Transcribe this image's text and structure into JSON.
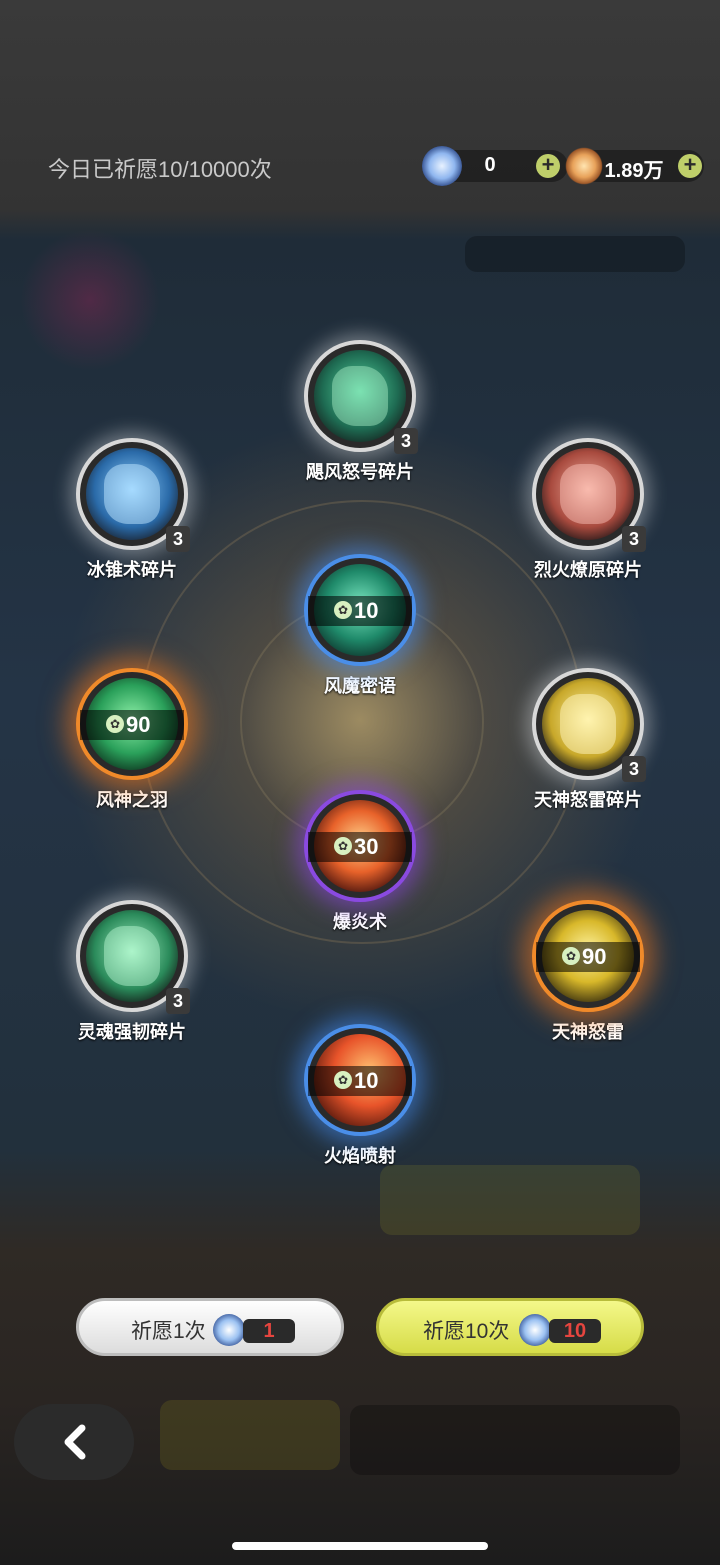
{
  "header": {
    "wish_count": "今日已祈愿10/10000次",
    "crystal_value": "0",
    "crystal_icon": "blue-crystal-icon",
    "star_value": "1.89万",
    "star_icon": "orange-star-icon",
    "plus_symbol": "+"
  },
  "items": [
    {
      "name": "飓风怒号碎片",
      "kind": "fragment",
      "count": "3",
      "rarity": "grey",
      "color": "#2fa37a"
    },
    {
      "name": "冰锥术碎片",
      "kind": "fragment",
      "count": "3",
      "rarity": "grey",
      "color": "#4aa7e8"
    },
    {
      "name": "烈火燎原碎片",
      "kind": "fragment",
      "count": "3",
      "rarity": "grey",
      "color": "#e07a6a"
    },
    {
      "name": "风魔密语",
      "kind": "skill",
      "count": "10",
      "rarity": "blue",
      "color": "#3fb890"
    },
    {
      "name": "风神之羽",
      "kind": "skill",
      "count": "90",
      "rarity": "orange",
      "color": "#3bbf6a"
    },
    {
      "name": "天神怒雷碎片",
      "kind": "fragment",
      "count": "3",
      "rarity": "grey",
      "color": "#e8d060"
    },
    {
      "name": "爆炎术",
      "kind": "skill",
      "count": "30",
      "rarity": "purple",
      "color": "#e8622a"
    },
    {
      "name": "灵魂强韧碎片",
      "kind": "fragment",
      "count": "3",
      "rarity": "grey",
      "color": "#4ac98a"
    },
    {
      "name": "天神怒雷",
      "kind": "skill",
      "count": "90",
      "rarity": "orange",
      "color": "#e8d23a"
    },
    {
      "name": "火焰喷射",
      "kind": "skill",
      "count": "10",
      "rarity": "blue",
      "color": "#e8542a"
    }
  ],
  "buttons": {
    "wish_once_label": "祈愿1次",
    "wish_once_cost": "1",
    "wish_ten_label": "祈愿10次",
    "wish_ten_cost": "10",
    "gem_icon": "crystal-icon"
  },
  "nav": {
    "back_icon": "chevron-left-icon"
  }
}
